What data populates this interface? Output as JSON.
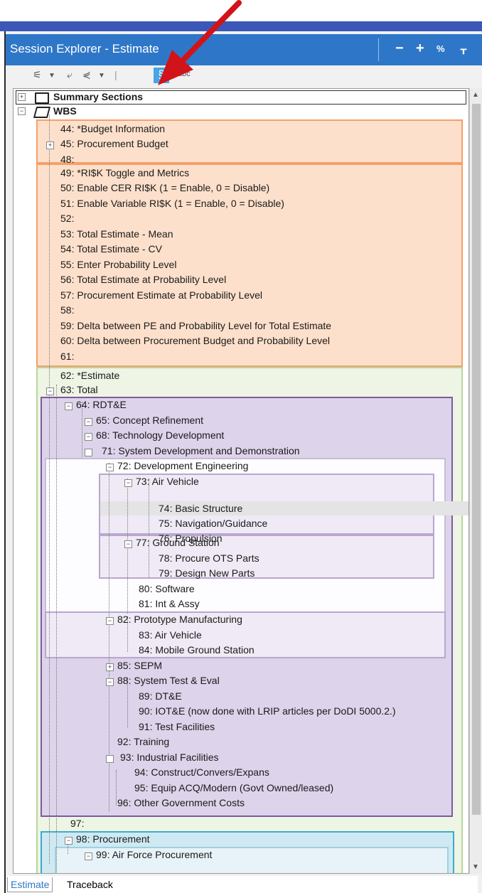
{
  "window": {
    "title": "Session Explorer - Estimate",
    "buttons": [
      "−",
      "+",
      "%",
      "ᚁ"
    ]
  },
  "toolbar": {
    "abc_label": "abc",
    "section_label": "§"
  },
  "tree": {
    "summary": "Summary Sections",
    "wbs": "WBS",
    "items": [
      "44: *Budget Information",
      "45: Procurement Budget",
      "48:",
      "49: *RI$K Toggle and Metrics",
      "50: Enable CER RI$K (1 = Enable, 0 = Disable)",
      "51: Enable Variable RI$K (1 = Enable, 0 = Disable)",
      "52:",
      "53: Total Estimate - Mean",
      "54: Total Estimate - CV",
      "55: Enter Probability Level",
      "56: Total Estimate at Probability Level",
      "57: Procurement Estimate at Probability Level",
      "58:",
      "59: Delta between PE and Probability Level for Total Estimate",
      "60: Delta between Procurement Budget and Probability Level",
      "61:",
      "62: *Estimate",
      "63: Total",
      "64: RDT&E",
      "65: Concept Refinement",
      "68: Technology Development",
      "71: System Development and Demonstration",
      "72: Development Engineering",
      "73: Air Vehicle",
      "74: Basic Structure",
      "75: Navigation/Guidance",
      "76: Propulsion",
      "77: Ground Station",
      "78: Procure OTS Parts",
      "79: Design New Parts",
      "80: Software",
      "81: Int & Assy",
      "82: Prototype Manufacturing",
      "83: Air Vehicle",
      "84: Mobile Ground Station",
      "85: SEPM",
      "88: System Test & Eval",
      "89: DT&E",
      "90: IOT&E (now done with LRIP articles per DoDI 5000.2.)",
      "91: Test Facilities",
      "92: Training",
      "93: Industrial Facilities",
      "94: Construct/Convers/Expans",
      "95: Equip ACQ/Modern (Govt Owned/leased)",
      "96: Other Government Costs",
      "97:",
      "98: Procurement",
      "99: Air Force Procurement"
    ]
  },
  "tabs": [
    "Estimate",
    "Traceback"
  ],
  "colors": {
    "accent": "#2e77c8",
    "arrow": "#d0141a",
    "band": "#3b58b8"
  }
}
